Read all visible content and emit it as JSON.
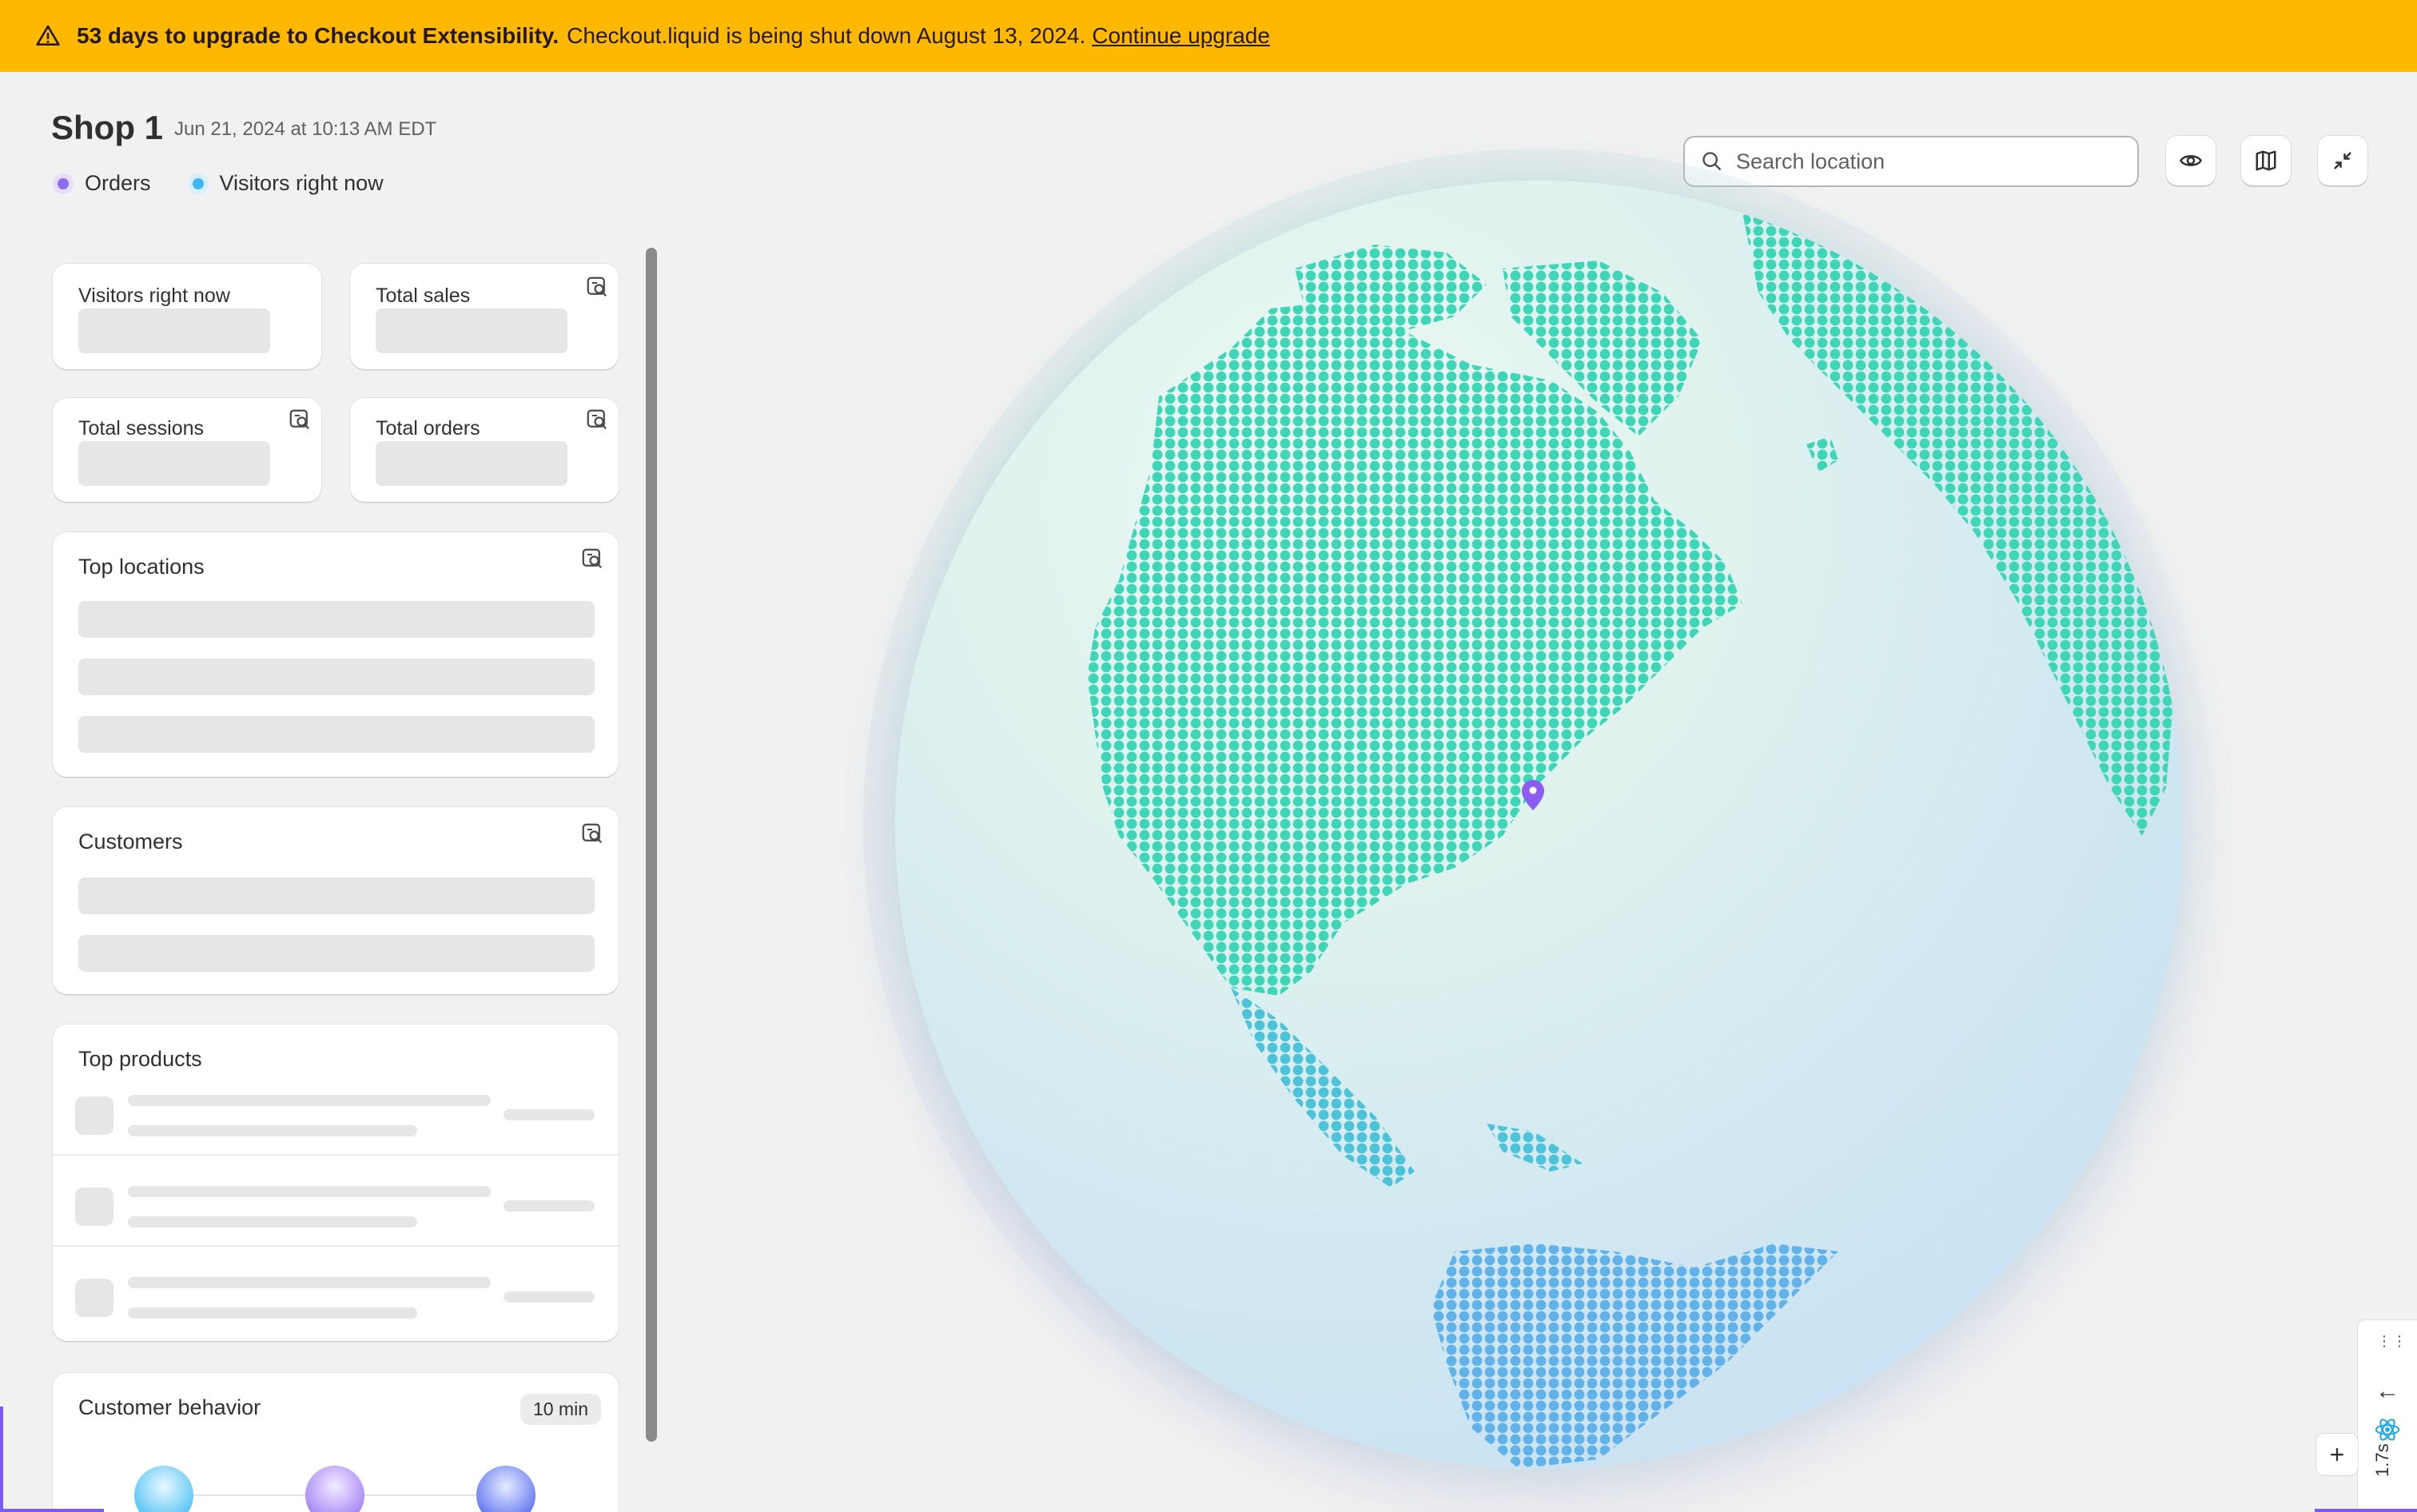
{
  "banner": {
    "bold_text": "53 days to upgrade to Checkout Extensibility.",
    "text": "Checkout.liquid is being shut down August 13, 2024.",
    "link": "Continue upgrade",
    "icon": "warning-icon",
    "color": "#ffb800"
  },
  "header": {
    "title": "Shop 1",
    "date": "Jun 21, 2024 at 10:13 AM EDT"
  },
  "legend": [
    {
      "label": "Orders",
      "color": "#8c6cf0"
    },
    {
      "label": "Visitors right now",
      "color": "#3cb6f5"
    }
  ],
  "cards": {
    "visitors": {
      "title": "Visitors right now"
    },
    "sales": {
      "title": "Total sales",
      "icon": "report-search-icon"
    },
    "sessions": {
      "title": "Total sessions",
      "icon": "report-search-icon"
    },
    "orders": {
      "title": "Total orders",
      "icon": "report-search-icon"
    },
    "top_locations": {
      "title": "Top locations",
      "icon": "report-search-icon"
    },
    "customers": {
      "title": "Customers",
      "icon": "report-search-icon"
    },
    "top_products": {
      "title": "Top products"
    },
    "customer_behavior": {
      "title": "Customer behavior",
      "badge": "10 min"
    }
  },
  "search": {
    "placeholder": "Search location",
    "icon": "search-icon"
  },
  "controls": [
    {
      "name": "eye-icon"
    },
    {
      "name": "map-icon"
    },
    {
      "name": "collapse-icon"
    }
  ],
  "globe": {
    "land_color": "#3fd6b8",
    "marker_color": "#8c5cf0"
  },
  "devtools": {
    "time": "1.7s",
    "plus": "+"
  }
}
